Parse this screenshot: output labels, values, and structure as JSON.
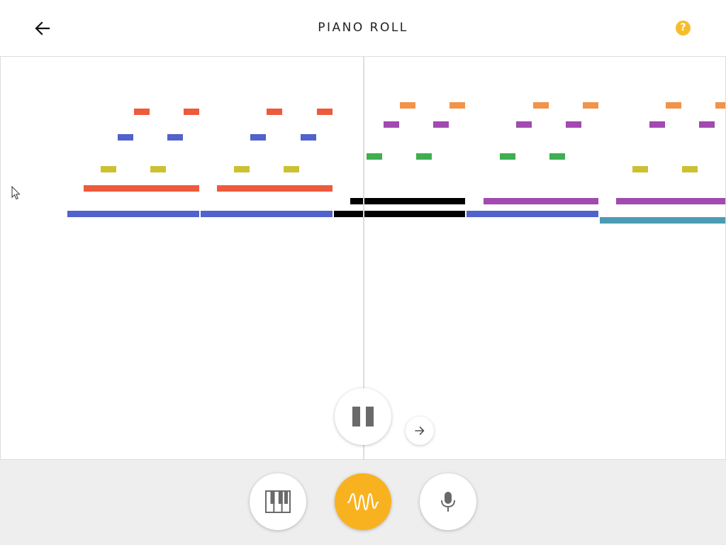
{
  "header": {
    "title": "PIANO ROLL",
    "back_icon": "arrow-left-icon",
    "help_label": "?",
    "help_color": "#f6bd2a"
  },
  "colors": {
    "red": "#ee5a3c",
    "blue": "#5062cc",
    "yellow": "#cdc133",
    "orange": "#f1944a",
    "purple": "#a14aaf",
    "green": "#3fae51",
    "black": "#000000",
    "teal": "#4c9bb3",
    "accent": "#f9b21f",
    "playhead": "#dddddd"
  },
  "controls": {
    "pause_icon": "pause-icon",
    "next_icon": "arrow-right-icon"
  },
  "modes": [
    {
      "name": "piano",
      "icon": "piano-keys-icon",
      "active": false
    },
    {
      "name": "wave",
      "icon": "waveform-icon",
      "active": true
    },
    {
      "name": "microphone",
      "icon": "microphone-icon",
      "active": false
    }
  ]
}
